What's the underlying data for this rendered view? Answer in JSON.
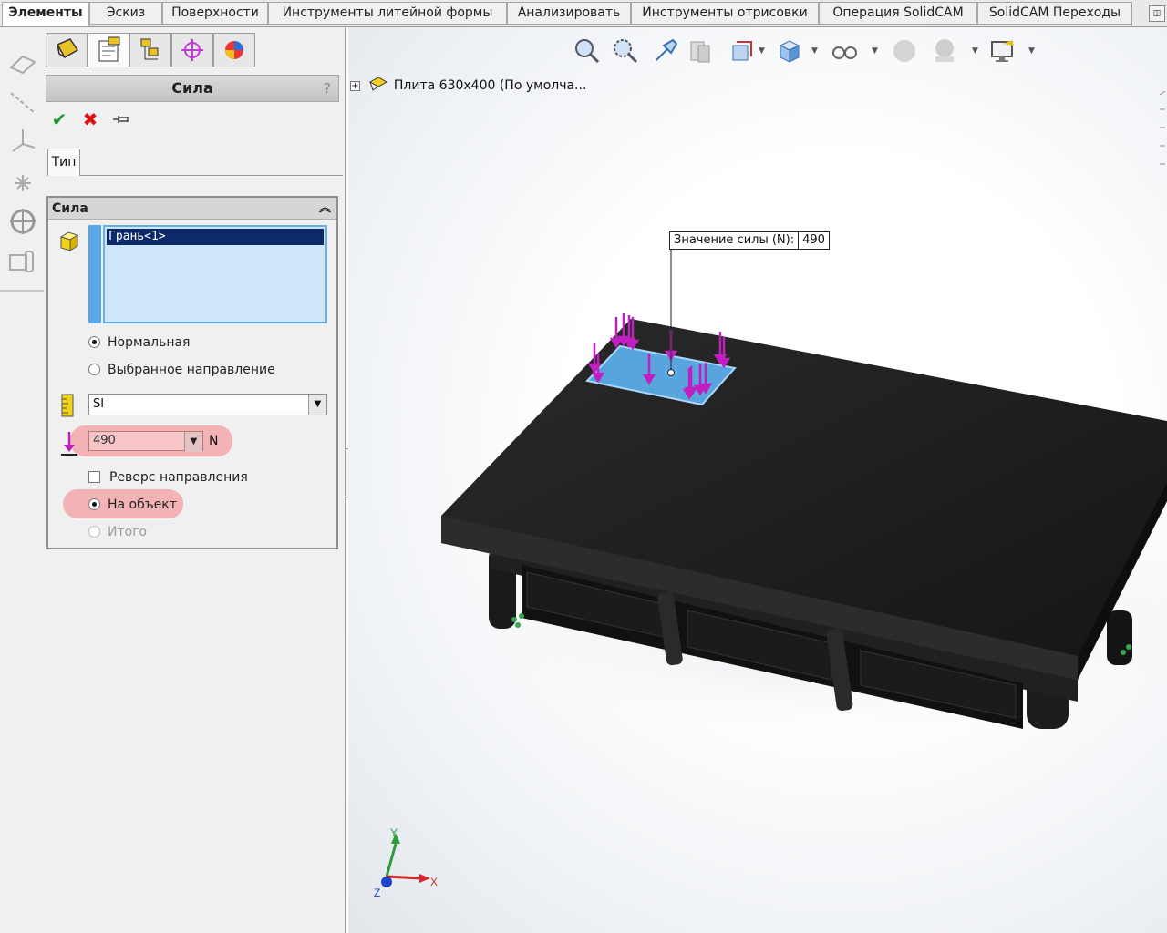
{
  "tabs": [
    {
      "label": "Элементы",
      "active": true
    },
    {
      "label": "Эскиз"
    },
    {
      "label": "Поверхности"
    },
    {
      "label": "Инструменты литейной формы"
    },
    {
      "label": "Анализировать"
    },
    {
      "label": "Инструменты отрисовки"
    },
    {
      "label": "Операция  SolidCAM"
    },
    {
      "label": "SolidCAM Переходы"
    }
  ],
  "property_manager": {
    "title": "Сила",
    "help": "?",
    "subtab": "Тип",
    "group_title": "Сила",
    "selection": "Грань<1>",
    "radio_normal": "Нормальная",
    "radio_selected_dir": "Выбранное направление",
    "unit_system": "SI",
    "force_value": "490",
    "force_unit": "N",
    "reverse_direction": "Реверс направления",
    "per_item": "На объект",
    "total": "Итого"
  },
  "viewport": {
    "tree_item": "Плита 630x400  (По умолча...",
    "callout_label": "Значение силы (N):",
    "callout_value": "490"
  },
  "triad": {
    "x": "X",
    "y": "Y",
    "z": "Z"
  },
  "colors": {
    "accent_blue": "#5aa6ea",
    "highlight": "#f3a7ab",
    "force_arrow": "#c020c0",
    "plate": "#1e1e1e",
    "selected_face": "#5eb2f2"
  }
}
